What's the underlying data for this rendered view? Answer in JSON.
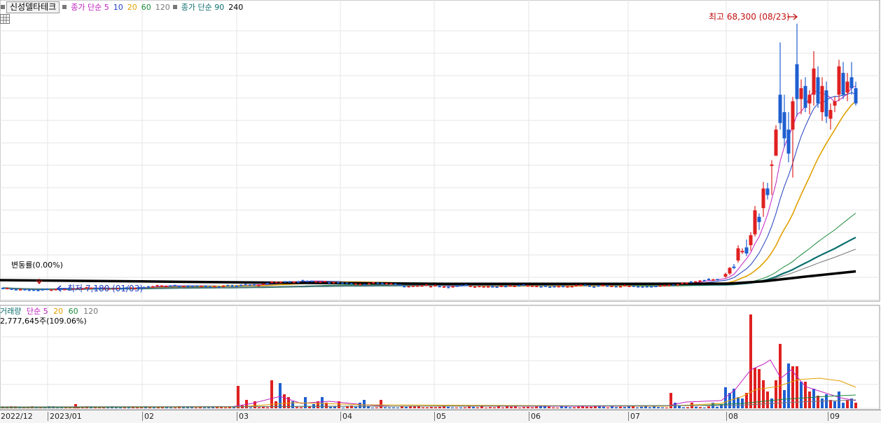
{
  "header": {
    "stock_name": "신성델타테크",
    "ma_legend": [
      {
        "label": "종가 단순 5",
        "color": "#c020c0"
      },
      {
        "label": "10",
        "color": "#1f3fbf"
      },
      {
        "label": "20",
        "color": "#e0a000"
      },
      {
        "label": "60",
        "color": "#1a8a3a"
      },
      {
        "label": "120",
        "color": "#777777"
      },
      {
        "label": "종가 단순 90",
        "color": "#0d6f6f"
      },
      {
        "label": "240",
        "color": "#000000"
      }
    ]
  },
  "annotations": {
    "high_label": "최고 68,300 (08/23)",
    "low_label": "최저 7,180 (01/03)",
    "change_label": "변동률(0.00%)"
  },
  "volume_panel": {
    "legend": [
      {
        "label": "거래량",
        "color": "#0d6f6f"
      },
      {
        "label": "단순 5",
        "color": "#c020c0"
      },
      {
        "label": "20",
        "color": "#e0a000"
      },
      {
        "label": "60",
        "color": "#1a8a3a"
      },
      {
        "label": "120",
        "color": "#777777"
      }
    ],
    "current_value": "2,777,645주(109.06%)"
  },
  "chart_data": {
    "type": "candlestick",
    "x_ticks": [
      "2022/12",
      "2023/01",
      "02",
      "03",
      "04",
      "05",
      "06",
      "07",
      "08",
      "09"
    ],
    "price_high": 68300,
    "price_high_date": "08/23",
    "price_low": 7180,
    "price_low_date": "01/03",
    "colors": {
      "up": "#e02020",
      "down": "#1f5fd0"
    },
    "candles": [
      {
        "period": "2023/07 late",
        "open": 10300,
        "high": 11200,
        "low": 10000,
        "close": 10900
      },
      {
        "period": "08 early",
        "open": 14000,
        "high": 17500,
        "low": 13500,
        "close": 16800
      },
      {
        "period": "08 early",
        "open": 20000,
        "high": 26500,
        "low": 19500,
        "close": 25500
      },
      {
        "period": "08 mid",
        "open": 26000,
        "high": 32000,
        "low": 24000,
        "close": 30500
      },
      {
        "period": "08 mid",
        "open": 30000,
        "high": 37000,
        "low": 29000,
        "close": 36000
      },
      {
        "period": "08 mid",
        "open": 41000,
        "high": 45000,
        "low": 38500,
        "close": 44000
      },
      {
        "period": "08 late",
        "open": 50000,
        "high": 64000,
        "low": 44000,
        "close": 45500
      },
      {
        "period": "08 late",
        "open": 59000,
        "high": 68300,
        "low": 47000,
        "close": 51000
      },
      {
        "period": "09 early",
        "open": 52000,
        "high": 62000,
        "low": 49500,
        "close": 58000
      },
      {
        "period": "09 early",
        "open": 56000,
        "high": 59500,
        "low": 52000,
        "close": 53500
      }
    ],
    "moving_averages_end": {
      "ma5": 55500,
      "ma10": 54500,
      "ma20": 51500,
      "ma60": 27500,
      "ma90": 21000,
      "ma120": 18500,
      "ma240": 11500
    }
  }
}
